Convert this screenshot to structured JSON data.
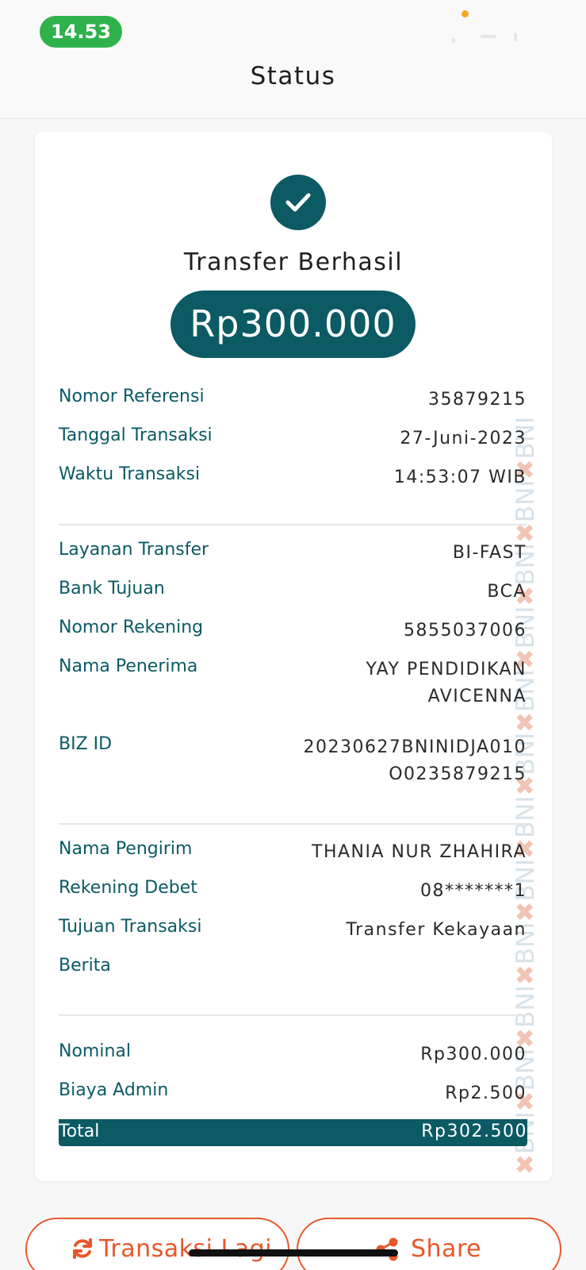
{
  "status_bar": {
    "time": "14.53"
  },
  "header": {
    "title": "Status"
  },
  "receipt": {
    "status_title": "Transfer Berhasil",
    "amount": "Rp300.000",
    "watermark": "BNI",
    "sections": [
      [
        {
          "label": "Nomor Referensi",
          "value": "35879215"
        },
        {
          "label": "Tanggal Transaksi",
          "value": "27-Juni-2023"
        },
        {
          "label": "Waktu Transaksi",
          "value": "14:53:07 WIB"
        }
      ],
      [
        {
          "label": "Layanan Transfer",
          "value": "BI-FAST"
        },
        {
          "label": "Bank Tujuan",
          "value": "BCA"
        },
        {
          "label": "Nomor Rekening",
          "value": "5855037006"
        },
        {
          "label": "Nama Penerima",
          "value": "YAY PENDIDIKAN AVICENNA"
        },
        {
          "label": "BIZ ID",
          "value": "20230627BNINIDJA010O0235879215"
        }
      ],
      [
        {
          "label": "Nama Pengirim",
          "value": "THANIA NUR ZHAHIRA"
        },
        {
          "label": "Rekening Debet",
          "value": "08*******1"
        },
        {
          "label": "Tujuan Transaksi",
          "value": "Transfer Kekayaan"
        },
        {
          "label": "Berita",
          "value": ""
        }
      ],
      [
        {
          "label": "Nominal",
          "value": "Rp300.000"
        },
        {
          "label": "Biaya Admin",
          "value": "Rp2.500"
        }
      ]
    ],
    "total": {
      "label": "Total",
      "value": "Rp302.500"
    }
  },
  "actions": {
    "again_label": "Transaksi Lagi",
    "share_label": "Share"
  },
  "colors": {
    "primary": "#0b5a64",
    "accent": "#e8572a",
    "time_pill": "#2fb24c"
  },
  "icons": [
    "check-icon",
    "refresh-icon",
    "share-icon"
  ]
}
